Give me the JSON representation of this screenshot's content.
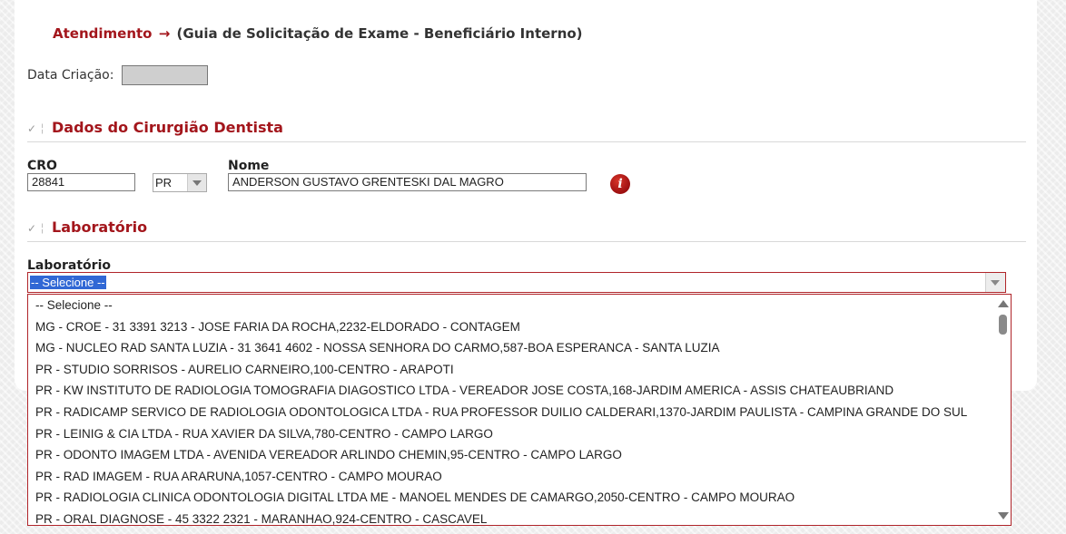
{
  "breadcrumb": {
    "main": "Atendimento",
    "arrow": "→",
    "page": "(Guia de Solicitação de Exame - Beneficiário Interno)"
  },
  "date": {
    "label": "Data Criação:",
    "value": ""
  },
  "dentist_section": {
    "title": "Dados do Cirurgião Dentista",
    "cro_label": "CRO",
    "cro_value": "28841",
    "uf_value": "PR",
    "name_label": "Nome",
    "name_value": "ANDERSON GUSTAVO GRENTESKI DAL MAGRO",
    "info_glyph": "i"
  },
  "lab_section": {
    "title": "Laboratório",
    "field_label": "Laboratório",
    "selected": "-- Selecione --",
    "options": [
      "-- Selecione --",
      "MG - CROE - 31 3391 3213 - JOSE FARIA DA ROCHA,2232-ELDORADO - CONTAGEM",
      "MG - NUCLEO RAD SANTA LUZIA - 31 3641 4602 - NOSSA SENHORA DO CARMO,587-BOA ESPERANCA - SANTA LUZIA",
      "PR - STUDIO SORRISOS - AURELIO CARNEIRO,100-CENTRO - ARAPOTI",
      "PR - KW INSTITUTO DE RADIOLOGIA TOMOGRAFIA DIAGOSTICO LTDA - VEREADOR JOSE COSTA,168-JARDIM AMERICA - ASSIS CHATEAUBRIAND",
      "PR - RADICAMP SERVICO DE RADIOLOGIA ODONTOLOGICA LTDA - RUA PROFESSOR DUILIO CALDERARI,1370-JARDIM PAULISTA - CAMPINA GRANDE DO SUL",
      "PR - LEINIG & CIA LTDA - RUA XAVIER DA SILVA,780-CENTRO - CAMPO LARGO",
      "PR - ODONTO IMAGEM LTDA - AVENIDA VEREADOR ARLINDO CHEMIN,95-CENTRO - CAMPO LARGO",
      "PR - RAD IMAGEM - RUA ARARUNA,1057-CENTRO - CAMPO MOURAO",
      "PR - RADIOLOGIA CLINICA ODONTOLOGIA DIGITAL LTDA ME - MANOEL MENDES DE CAMARGO,2050-CENTRO - CAMPO MOURAO",
      "PR - ORAL DIAGNOSE - 45 3322 2321 - MARANHAO,924-CENTRO - CASCAVEL"
    ]
  },
  "icons": {
    "check": "✓",
    "separator": "¦",
    "section_check": "check-icon",
    "info": "info-icon",
    "dropdown_arrow": "chevron-down-icon"
  },
  "colors": {
    "accent": "#a3161c",
    "selection": "#3168d5",
    "info_icon": "#b31b1b"
  }
}
